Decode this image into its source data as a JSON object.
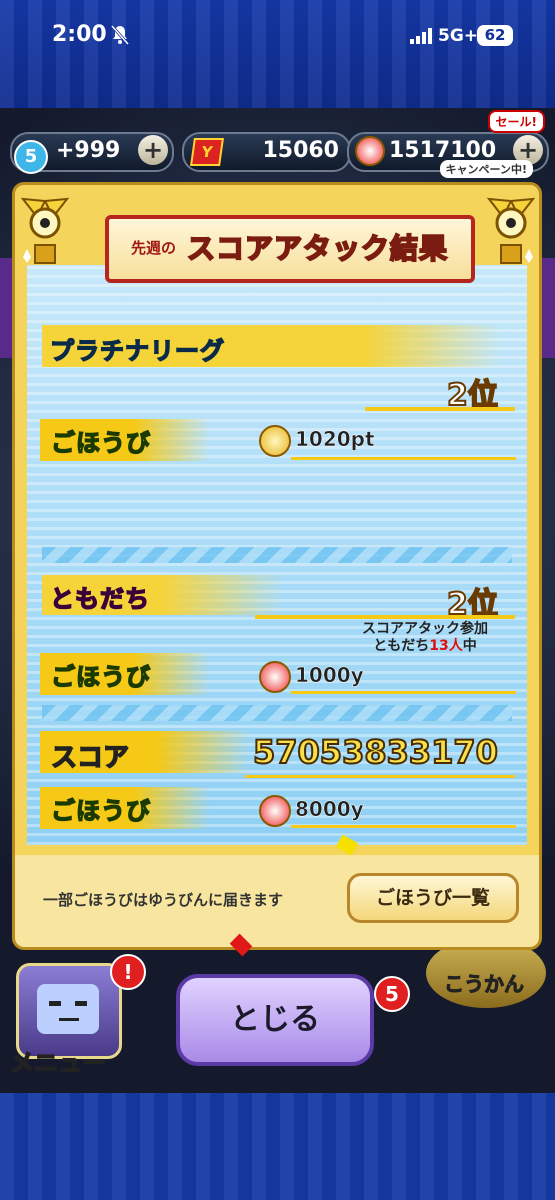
{
  "status": {
    "time": "2:00",
    "network": "5G+",
    "battery": "62"
  },
  "currency": {
    "stamina_count": "5",
    "stamina_bonus": "+999",
    "y_points": "15060",
    "y_money": "1517100",
    "sale_tag": "セール!",
    "campaign_tag": "キャンペーン中!"
  },
  "modal": {
    "title_small": "先週の",
    "title_main": "スコアアタック結果",
    "league": {
      "label": "プラチナリーグ",
      "rank": "2位",
      "reward_label": "ごほうび",
      "reward_value": "1020pt"
    },
    "friends": {
      "label": "ともだち",
      "rank": "2位",
      "info_line1": "スコアアタック参加",
      "info_line2_prefix": "ともだち",
      "info_line2_count": "13人",
      "info_line2_suffix": "中",
      "reward_label": "ごほうび",
      "reward_value": "1000y"
    },
    "score": {
      "label": "スコア",
      "value": "57053833170",
      "reward_label": "ごほうび",
      "reward_value": "8000y"
    },
    "footer_note": "一部ごほうびはゆうびんに届きます",
    "list_button": "ごほうび一覧"
  },
  "bottom": {
    "close_button": "とじる",
    "menu_label": "メニュー",
    "menu_badge": "!",
    "exchange_label": "こうかん",
    "exchange_badge": "5"
  },
  "colors": {
    "frame_blue": "#12309a",
    "modal_gold": "#f5d45c",
    "panel_blue": "#8fd0f4",
    "close_purple": "#a98ae8"
  }
}
